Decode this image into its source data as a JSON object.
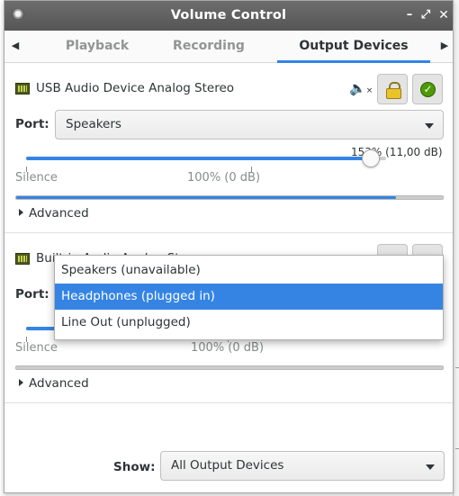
{
  "window": {
    "title": "Volume Control",
    "controls": [
      "minimize-icon",
      "maximize-icon",
      "close-icon"
    ]
  },
  "tabs": [
    {
      "label": "Playback",
      "active": false
    },
    {
      "label": "Recording",
      "active": false
    },
    {
      "label": "Output Devices",
      "active": true
    }
  ],
  "devices": [
    {
      "name": "USB Audio Device Analog Stereo",
      "port_label": "Port:",
      "port_value": "Speakers",
      "volume_percent": 153,
      "volume_text": "153% (11,00 dB)",
      "scale_min": "Silence",
      "scale_mid": "100% (0 dB)",
      "level_fraction": 0.89,
      "advanced_label": "Advanced"
    },
    {
      "name": "Built-in Audio Analog Stereo",
      "port_label": "Port:",
      "scale_min": "Silence",
      "scale_mid": "100% (0 dB)",
      "level_fraction": 0.0,
      "advanced_label": "Advanced"
    }
  ],
  "port_popup": {
    "items": [
      {
        "label": "Speakers (unavailable)",
        "selected": false
      },
      {
        "label": "Headphones (plugged in)",
        "selected": true
      },
      {
        "label": "Line Out (unplugged)",
        "selected": false
      }
    ]
  },
  "footer": {
    "show_label": "Show:",
    "show_value": "All Output Devices"
  },
  "colors": {
    "accent": "#3584e4",
    "titlebar": "#5e5e5e"
  }
}
